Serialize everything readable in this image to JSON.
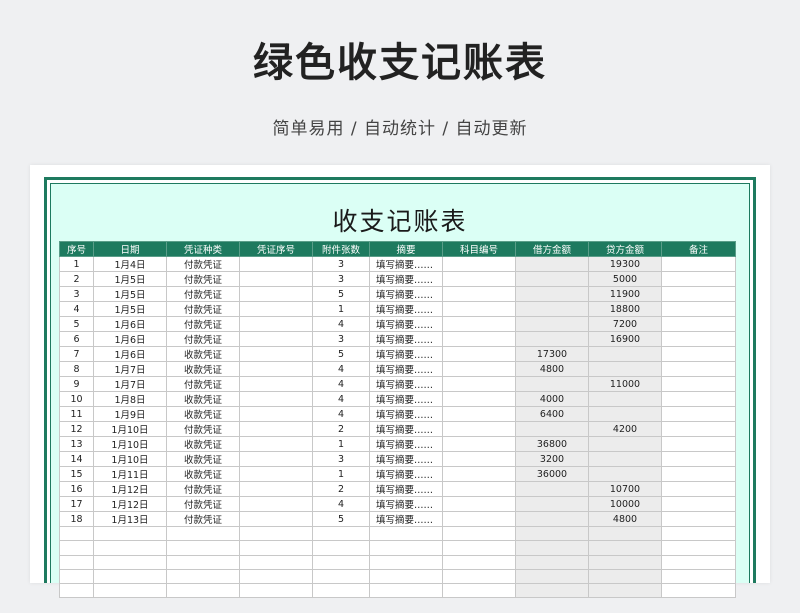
{
  "page": {
    "title": "绿色收支记账表",
    "subtitle": "简单易用 / 自动统计 / 自动更新"
  },
  "sheet": {
    "title": "收支记账表",
    "columns": [
      "序号",
      "日期",
      "凭证种类",
      "凭证序号",
      "附件张数",
      "摘要",
      "科目编号",
      "借方金额",
      "贷方金额",
      "备注"
    ],
    "rows": [
      {
        "no": "1",
        "date": "1月4日",
        "type": "付款凭证",
        "voucher": "",
        "attach": "3",
        "summary": "填写摘要……",
        "code": "",
        "debit": "",
        "credit": "19300",
        "note": ""
      },
      {
        "no": "2",
        "date": "1月5日",
        "type": "付款凭证",
        "voucher": "",
        "attach": "3",
        "summary": "填写摘要……",
        "code": "",
        "debit": "",
        "credit": "5000",
        "note": ""
      },
      {
        "no": "3",
        "date": "1月5日",
        "type": "付款凭证",
        "voucher": "",
        "attach": "5",
        "summary": "填写摘要……",
        "code": "",
        "debit": "",
        "credit": "11900",
        "note": ""
      },
      {
        "no": "4",
        "date": "1月5日",
        "type": "付款凭证",
        "voucher": "",
        "attach": "1",
        "summary": "填写摘要……",
        "code": "",
        "debit": "",
        "credit": "18800",
        "note": ""
      },
      {
        "no": "5",
        "date": "1月6日",
        "type": "付款凭证",
        "voucher": "",
        "attach": "4",
        "summary": "填写摘要……",
        "code": "",
        "debit": "",
        "credit": "7200",
        "note": ""
      },
      {
        "no": "6",
        "date": "1月6日",
        "type": "付款凭证",
        "voucher": "",
        "attach": "3",
        "summary": "填写摘要……",
        "code": "",
        "debit": "",
        "credit": "16900",
        "note": ""
      },
      {
        "no": "7",
        "date": "1月6日",
        "type": "收款凭证",
        "voucher": "",
        "attach": "5",
        "summary": "填写摘要……",
        "code": "",
        "debit": "17300",
        "credit": "",
        "note": ""
      },
      {
        "no": "8",
        "date": "1月7日",
        "type": "收款凭证",
        "voucher": "",
        "attach": "4",
        "summary": "填写摘要……",
        "code": "",
        "debit": "4800",
        "credit": "",
        "note": ""
      },
      {
        "no": "9",
        "date": "1月7日",
        "type": "付款凭证",
        "voucher": "",
        "attach": "4",
        "summary": "填写摘要……",
        "code": "",
        "debit": "",
        "credit": "11000",
        "note": ""
      },
      {
        "no": "10",
        "date": "1月8日",
        "type": "收款凭证",
        "voucher": "",
        "attach": "4",
        "summary": "填写摘要……",
        "code": "",
        "debit": "4000",
        "credit": "",
        "note": ""
      },
      {
        "no": "11",
        "date": "1月9日",
        "type": "收款凭证",
        "voucher": "",
        "attach": "4",
        "summary": "填写摘要……",
        "code": "",
        "debit": "6400",
        "credit": "",
        "note": ""
      },
      {
        "no": "12",
        "date": "1月10日",
        "type": "付款凭证",
        "voucher": "",
        "attach": "2",
        "summary": "填写摘要……",
        "code": "",
        "debit": "",
        "credit": "4200",
        "note": ""
      },
      {
        "no": "13",
        "date": "1月10日",
        "type": "收款凭证",
        "voucher": "",
        "attach": "1",
        "summary": "填写摘要……",
        "code": "",
        "debit": "36800",
        "credit": "",
        "note": ""
      },
      {
        "no": "14",
        "date": "1月10日",
        "type": "收款凭证",
        "voucher": "",
        "attach": "3",
        "summary": "填写摘要……",
        "code": "",
        "debit": "3200",
        "credit": "",
        "note": ""
      },
      {
        "no": "15",
        "date": "1月11日",
        "type": "收款凭证",
        "voucher": "",
        "attach": "1",
        "summary": "填写摘要……",
        "code": "",
        "debit": "36000",
        "credit": "",
        "note": ""
      },
      {
        "no": "16",
        "date": "1月12日",
        "type": "付款凭证",
        "voucher": "",
        "attach": "2",
        "summary": "填写摘要……",
        "code": "",
        "debit": "",
        "credit": "10700",
        "note": ""
      },
      {
        "no": "17",
        "date": "1月12日",
        "type": "付款凭证",
        "voucher": "",
        "attach": "4",
        "summary": "填写摘要……",
        "code": "",
        "debit": "",
        "credit": "10000",
        "note": ""
      },
      {
        "no": "18",
        "date": "1月13日",
        "type": "付款凭证",
        "voucher": "",
        "attach": "5",
        "summary": "填写摘要……",
        "code": "",
        "debit": "",
        "credit": "4800",
        "note": ""
      },
      {
        "no": "",
        "date": "",
        "type": "",
        "voucher": "",
        "attach": "",
        "summary": "",
        "code": "",
        "debit": "",
        "credit": "",
        "note": ""
      },
      {
        "no": "",
        "date": "",
        "type": "",
        "voucher": "",
        "attach": "",
        "summary": "",
        "code": "",
        "debit": "",
        "credit": "",
        "note": ""
      },
      {
        "no": "",
        "date": "",
        "type": "",
        "voucher": "",
        "attach": "",
        "summary": "",
        "code": "",
        "debit": "",
        "credit": "",
        "note": ""
      },
      {
        "no": "",
        "date": "",
        "type": "",
        "voucher": "",
        "attach": "",
        "summary": "",
        "code": "",
        "debit": "",
        "credit": "",
        "note": ""
      },
      {
        "no": "",
        "date": "",
        "type": "",
        "voucher": "",
        "attach": "",
        "summary": "",
        "code": "",
        "debit": "",
        "credit": "",
        "note": ""
      }
    ]
  },
  "colors": {
    "accent": "#1e7a5f",
    "title_band": "#dbfff5",
    "amount_cell": "#ececec"
  }
}
